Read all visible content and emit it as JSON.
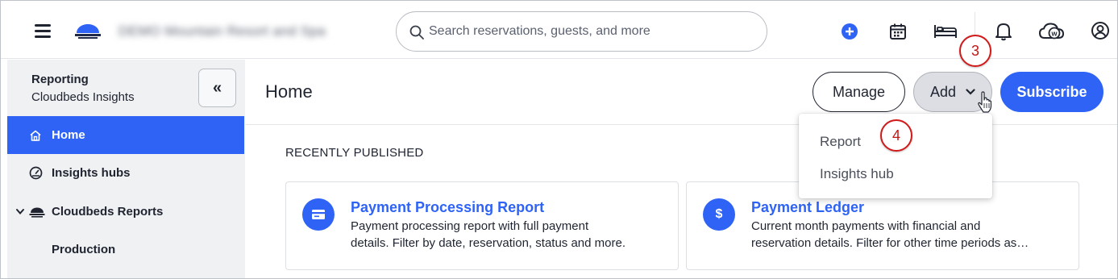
{
  "header": {
    "property_name": "DEMO Mountain Resort and Spa",
    "search_placeholder": "Search reservations, guests, and more",
    "icons": [
      "menu-icon",
      "cloudbeds-logo-icon",
      "search-icon",
      "add-circle-icon",
      "calendar-icon",
      "bed-icon",
      "bell-icon",
      "whistle-cloud-icon",
      "user-icon"
    ]
  },
  "sidebar": {
    "title": "Reporting",
    "subtitle": "Cloudbeds Insights",
    "collapse_label": "«",
    "items": [
      {
        "label": "Home",
        "icon": "home-icon",
        "active": true
      },
      {
        "label": "Insights hubs",
        "icon": "gauge-icon",
        "active": false
      },
      {
        "label": "Cloudbeds Reports",
        "icon": "cloudbeds-logo-icon",
        "expanded": true
      },
      {
        "label": "Production",
        "icon": "",
        "active": false
      }
    ]
  },
  "main": {
    "title": "Home",
    "manage_label": "Manage",
    "add_label": "Add",
    "subscribe_label": "Subscribe",
    "add_menu": [
      "Report",
      "Insights hub"
    ],
    "section_title": "RECENTLY PUBLISHED",
    "cards": [
      {
        "title": "Payment Processing Report",
        "icon": "credit-card-icon",
        "desc_line1": "Payment processing report with full payment",
        "desc_line2": "details. Filter by date, reservation, status and more."
      },
      {
        "title": "Payment Ledger",
        "icon": "dollar-icon",
        "icon_text": "$",
        "desc_line1": "Current month payments with financial and",
        "desc_line2": "reservation details. Filter for other time periods as…"
      }
    ]
  },
  "callouts": {
    "step3": "3",
    "step4": "4"
  },
  "colors": {
    "accent": "#2e63f6",
    "sidebar_bg": "#f0f1f3",
    "callout": "#d11a1a"
  }
}
